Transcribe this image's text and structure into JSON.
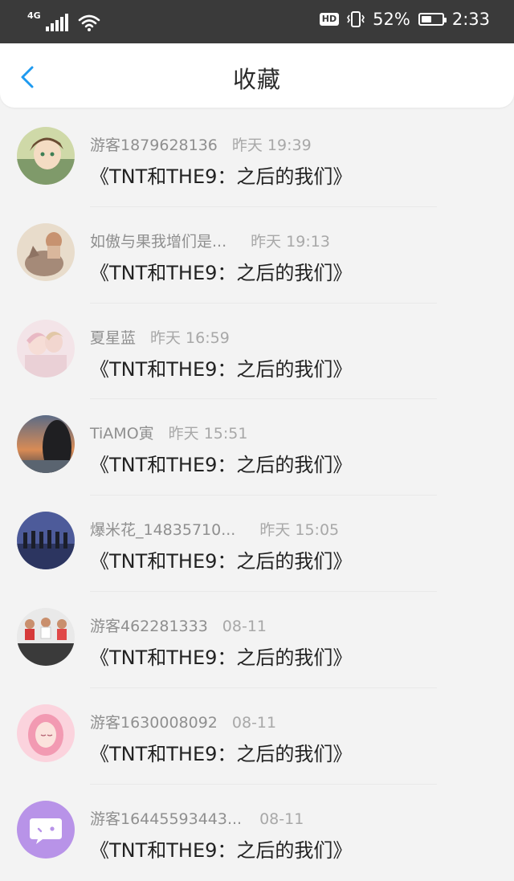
{
  "status_bar": {
    "network": "4G",
    "hd": "HD",
    "battery_percent_text": "52%",
    "battery_level": 0.52,
    "time": "2:33"
  },
  "header": {
    "title": "收藏"
  },
  "items": [
    {
      "name": "游客1879628136",
      "time": "昨天 19:39",
      "text": "《TNT和THE9：之后的我们》",
      "avatar": "anime-boy-avatar"
    },
    {
      "name": "如傲与果我增们是...",
      "time": "昨天 19:13",
      "text": "《TNT和THE9：之后的我们》",
      "avatar": "cat-girl-avatar"
    },
    {
      "name": "夏星蓝",
      "time": "昨天 16:59",
      "text": "《TNT和THE9：之后的我们》",
      "avatar": "anime-couple-avatar"
    },
    {
      "name": "TiAMO寅",
      "time": "昨天 15:51",
      "text": "《TNT和THE9：之后的我们》",
      "avatar": "sunset-girl-avatar"
    },
    {
      "name": "爆米花_14835710...",
      "time": "昨天 15:05",
      "text": "《TNT和THE9：之后的我们》",
      "avatar": "group-stage-avatar"
    },
    {
      "name": "游客462281333",
      "time": "08-11",
      "text": "《TNT和THE9：之后的我们》",
      "avatar": "cyclists-avatar"
    },
    {
      "name": "游客1630008092",
      "time": "08-11",
      "text": "《TNT和THE9：之后的我们》",
      "avatar": "pink-girl-avatar"
    },
    {
      "name": "游客16445593443...",
      "time": "08-11",
      "text": "《TNT和THE9：之后的我们》",
      "avatar": "chat-bubble-avatar"
    }
  ]
}
